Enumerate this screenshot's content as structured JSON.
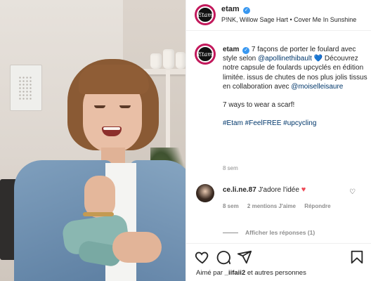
{
  "post": {
    "account": "etam",
    "avatar_text": "Etam",
    "music": "P!NK, Willow Sage Hart • Cover Me In Sunshine",
    "caption": {
      "username": "etam",
      "line1": "7 façons de porter le foulard avec style selon ",
      "mention1": "@apollinethibault",
      "line2": "Découvrez notre capsule de foulards upcyclés en édition limitée. issus de chutes de nos plus jolis tissus en collaboration avec ",
      "mention2": "@moiselleisaure",
      "english": "7 ways to wear a scarf!",
      "hashtags": "#Etam #FeelFREE #upcycling",
      "time": "8 sem"
    },
    "comment": {
      "username": "ce.li.ne.87",
      "text": "J'adore l'idée",
      "time": "8 sem",
      "likes": "2 mentions J'aime",
      "reply": "Répondre",
      "view_replies": "Afficher les réponses (1)"
    },
    "liked_by": {
      "prefix": "Aimé par ",
      "user": "_iifaii2",
      "suffix": " et autres personnes"
    }
  },
  "colors": {
    "link": "#00376b",
    "verified": "#3897f0",
    "heart": "#ed4956",
    "muted": "#8e8e8e"
  },
  "icons": [
    "verified-icon",
    "heart-icon",
    "comment-icon",
    "share-icon",
    "bookmark-icon",
    "heart-red-icon",
    "comment-like-icon"
  ]
}
